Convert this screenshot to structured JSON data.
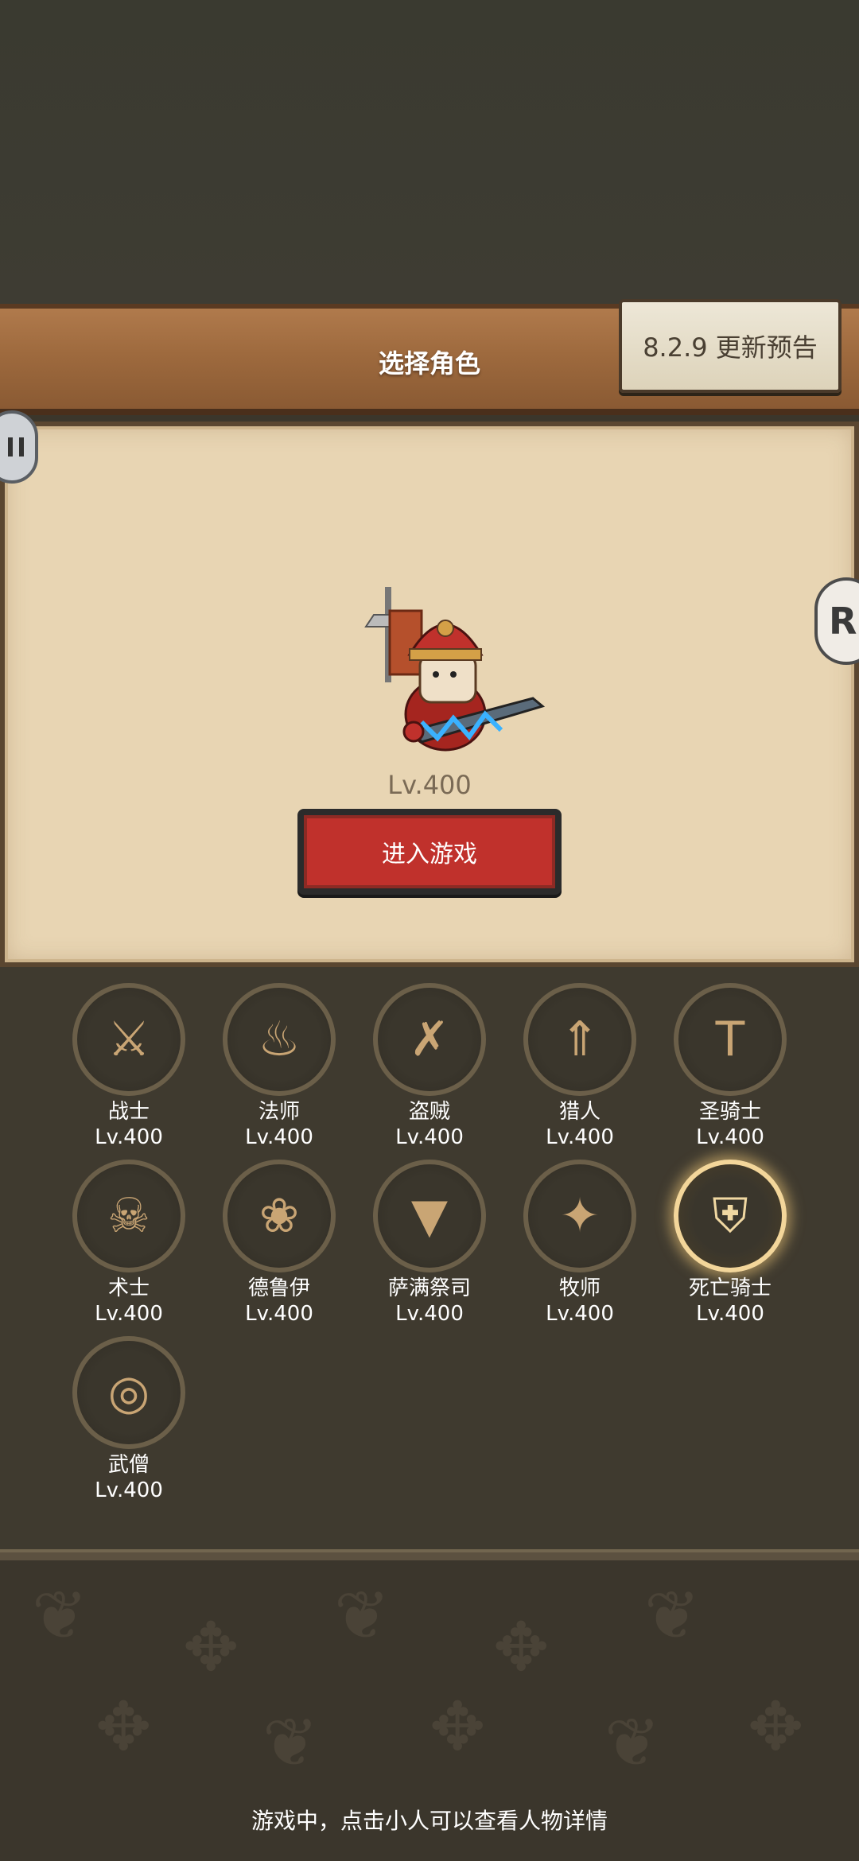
{
  "header": {
    "title": "选择角色",
    "notice_button": "8.2.9 更新预告"
  },
  "side_buttons": {
    "right_glyph": "R"
  },
  "character": {
    "level": "Lv.400",
    "enter_button": "进入游戏"
  },
  "classes": [
    {
      "name": "战士",
      "level": "Lv.400",
      "icon": "sword-shield-icon",
      "glyph": "⚔"
    },
    {
      "name": "法师",
      "level": "Lv.400",
      "icon": "flame-icon",
      "glyph": "♨"
    },
    {
      "name": "盗贼",
      "level": "Lv.400",
      "icon": "dagger-icon",
      "glyph": "✗"
    },
    {
      "name": "猎人",
      "level": "Lv.400",
      "icon": "arrows-icon",
      "glyph": "⇑"
    },
    {
      "name": "圣骑士",
      "level": "Lv.400",
      "icon": "hammer-icon",
      "glyph": "T"
    },
    {
      "name": "术士",
      "level": "Lv.400",
      "icon": "skull-icon",
      "glyph": "☠"
    },
    {
      "name": "德鲁伊",
      "level": "Lv.400",
      "icon": "paw-icon",
      "glyph": "❀"
    },
    {
      "name": "萨满祭司",
      "level": "Lv.400",
      "icon": "totem-icon",
      "glyph": "▼"
    },
    {
      "name": "牧师",
      "level": "Lv.400",
      "icon": "star-icon",
      "glyph": "✦"
    },
    {
      "name": "死亡骑士",
      "level": "Lv.400",
      "icon": "helm-icon",
      "glyph": "⛨",
      "selected": true
    },
    {
      "name": "武僧",
      "level": "Lv.400",
      "icon": "swirl-icon",
      "glyph": "◎"
    }
  ],
  "footer": {
    "tip": "游戏中，点击小人可以查看人物详情"
  }
}
